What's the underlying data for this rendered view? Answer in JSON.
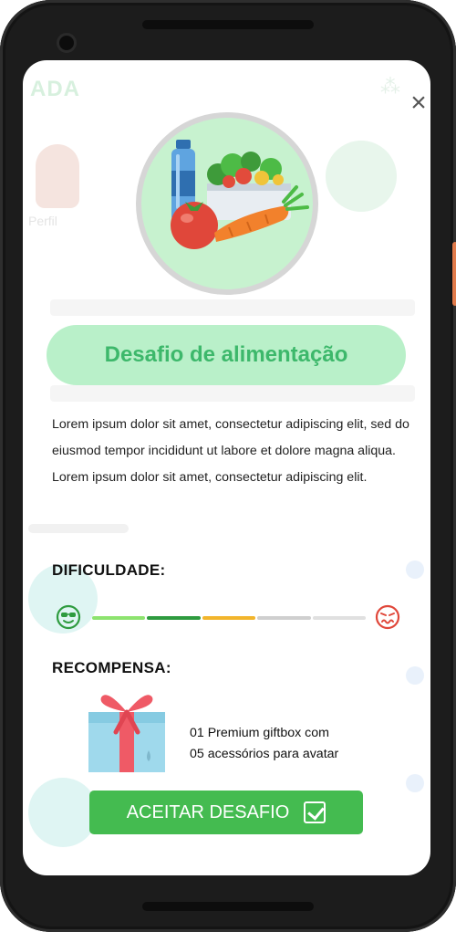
{
  "modal": {
    "close_icon": "×",
    "title": "Desafio de alimentação",
    "description_lines": [
      "Lorem ipsum dolor sit amet, consectetur adipiscing elit, sed do eiusmod tempor incididunt ut labore et dolore magna aliqua.",
      "Lorem ipsum dolor sit amet, consectetur adipiscing elit."
    ],
    "difficulty_label": "DIFICULDADE:",
    "difficulty_level": 0.4,
    "difficulty_bar_colors": [
      "#8de36f",
      "#2e9b3f",
      "#f2b52c",
      "#cfcfcf",
      "#e0e0e0"
    ],
    "reward_label": "RECOMPENSA:",
    "reward_lines": [
      "01 Premium giftbox com",
      "05 acessórios para avatar"
    ],
    "accept_label": "ACEITAR DESAFIO",
    "hero_icon": "healthy-food-icon",
    "easy_icon": "cool-face-icon",
    "hard_icon": "sick-face-icon",
    "gift_icon": "giftbox-icon"
  },
  "background": {
    "app_title": "ADA",
    "avatar_label": "Perfil"
  },
  "colors": {
    "accent": "#44bb50",
    "title_text": "#3db86b",
    "title_pill": "#b9f0c9",
    "hero_bg": "#c7f2cf"
  }
}
